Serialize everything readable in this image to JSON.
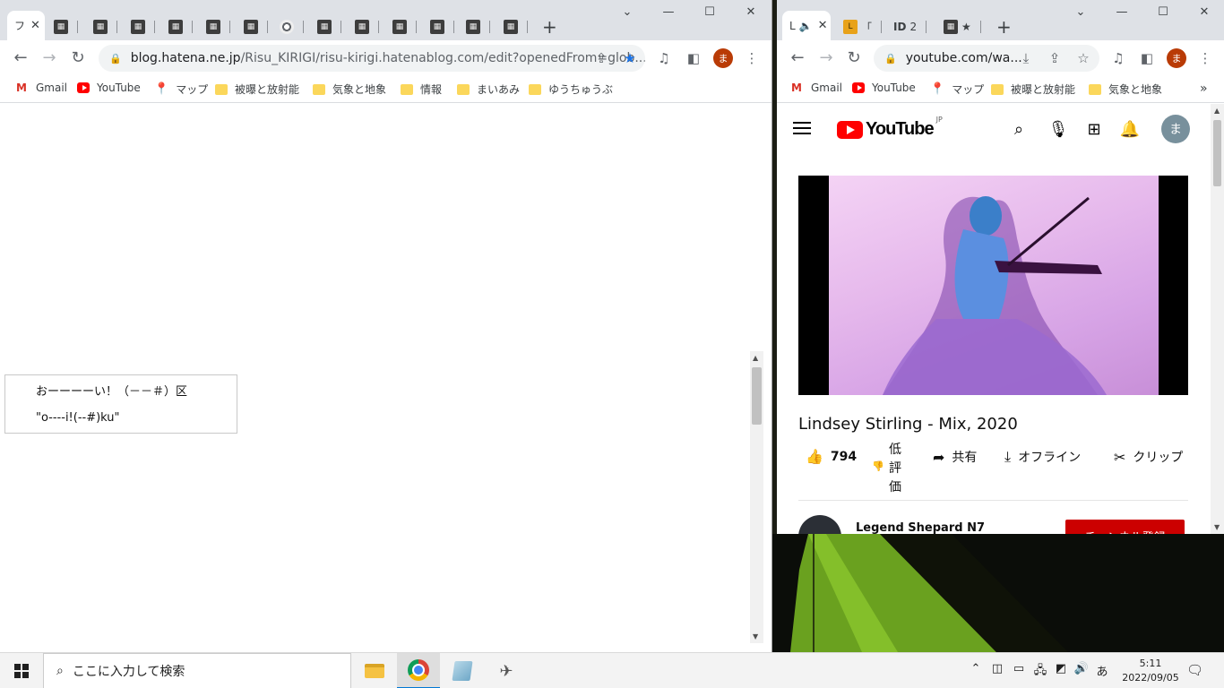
{
  "left_window": {
    "tabs": [
      {
        "label": "フ",
        "favicon": "tab-favicon-icon",
        "active": true,
        "close": "✕"
      },
      {
        "label": "",
        "favicon": "tab-favicon-icon"
      },
      {
        "label": "",
        "favicon": "tab-favicon-icon"
      },
      {
        "label": "",
        "favicon": "tab-favicon-icon"
      },
      {
        "label": "",
        "favicon": "tab-favicon-icon"
      },
      {
        "label": "",
        "favicon": "tab-favicon-icon"
      },
      {
        "label": "",
        "favicon": "tab-favicon-icon"
      },
      {
        "label": "",
        "favicon": "chrome-icon"
      },
      {
        "label": "",
        "favicon": "tab-favicon-icon"
      },
      {
        "label": "",
        "favicon": "tab-favicon-icon"
      },
      {
        "label": "",
        "favicon": "tab-favicon-icon"
      },
      {
        "label": "",
        "favicon": "tab-favicon-icon"
      },
      {
        "label": "",
        "favicon": "tab-favicon-icon"
      },
      {
        "label": "",
        "favicon": "tab-favicon-icon"
      }
    ],
    "new_tab": "+",
    "url_host": "blog.hatena.ne.jp",
    "url_rest": "/Risu_KIRIGI/risu-kirigi.hatenablog.com/edit?openedFrom=glob...",
    "avatar": "ま",
    "bookmarks": [
      {
        "label": "Gmail",
        "icon": "gmail-icon"
      },
      {
        "label": "YouTube",
        "icon": "youtube-icon"
      },
      {
        "label": "マップ",
        "icon": "maps-icon"
      },
      {
        "label": "被曝と放射能",
        "icon": "folder-icon"
      },
      {
        "label": "気象と地象",
        "icon": "folder-icon"
      },
      {
        "label": "情報",
        "icon": "folder-icon"
      },
      {
        "label": "まいあみ",
        "icon": "folder-icon"
      },
      {
        "label": "ゆうちゅうぶ",
        "icon": "folder-icon"
      }
    ],
    "editor": {
      "line1": "おーーーーい！（－－＃）区",
      "line2": "\"o----i!(--#)ku\""
    }
  },
  "right_window": {
    "tabs": [
      {
        "label": "L",
        "audio": "🔈",
        "active": true,
        "close": "✕"
      },
      {
        "label": "「",
        "favicon": "tab-favicon-icon"
      },
      {
        "label": "2",
        "favicon": "ID"
      },
      {
        "label": "",
        "favicon": "tab-favicon-icon"
      }
    ],
    "new_tab": "+",
    "url": "youtube.com/wa...",
    "avatar": "ま",
    "bookmarks": [
      {
        "label": "Gmail",
        "icon": "gmail-icon"
      },
      {
        "label": "YouTube",
        "icon": "youtube-icon"
      },
      {
        "label": "マップ",
        "icon": "maps-icon"
      },
      {
        "label": "被曝と放射能",
        "icon": "folder-icon"
      },
      {
        "label": "気象と地象",
        "icon": "folder-icon"
      }
    ],
    "more_bookmarks": "»",
    "youtube": {
      "logo_text": "YouTube",
      "region": "JP",
      "avatar": "ま",
      "video_title": "Lindsey Stirling - Mix, 2020",
      "likes": "794",
      "dislike_label": "低評価",
      "share": "共有",
      "offline": "オフライン",
      "clip": "クリップ",
      "channel_name": "Legend Shepard N7",
      "subscribe": "チャンネル登録"
    }
  },
  "taskbar": {
    "search_placeholder": "ここに入力して検索",
    "time": "5:11",
    "date": "2022/09/05",
    "ime": "あ"
  }
}
